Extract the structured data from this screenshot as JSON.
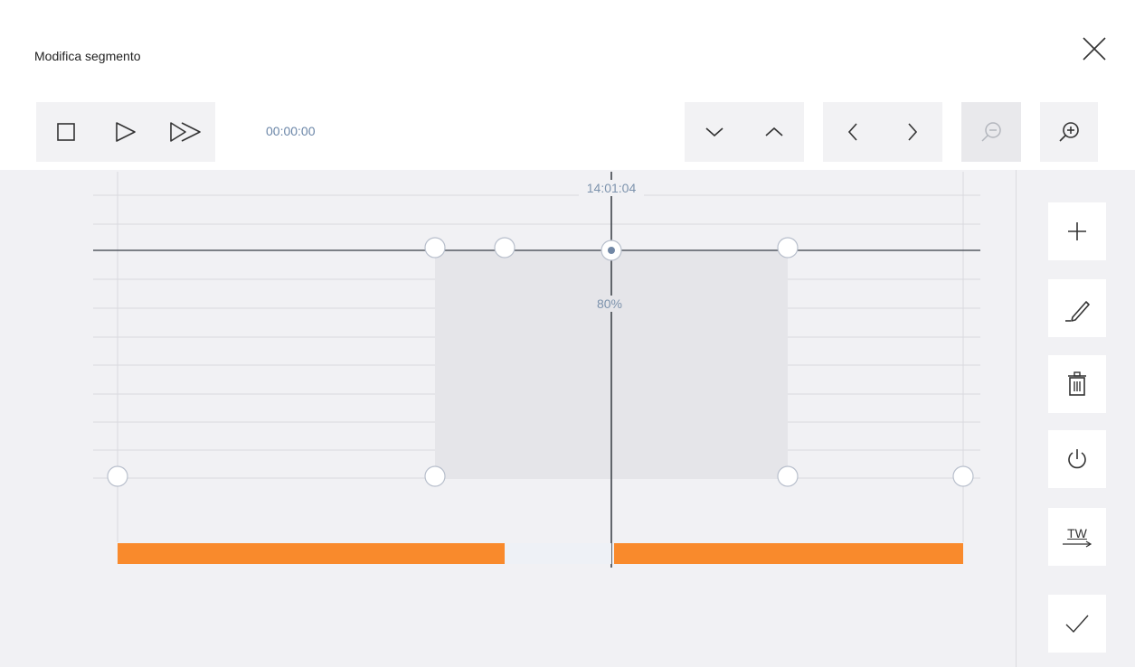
{
  "dialog": {
    "title": "Modifica segmento"
  },
  "toolbar": {
    "timecode": "00:00:00",
    "buttons": [
      "stop",
      "play",
      "fast-forward",
      "move-down",
      "move-up",
      "previous",
      "next",
      "zoom-out",
      "zoom-in"
    ],
    "zoom_out_enabled": false
  },
  "timeline": {
    "cursor_time": "14:01:04",
    "level_label": "80%",
    "envelope_handles": 8,
    "segment_colors": {
      "active": "#f98a2c",
      "inactive": "#eef1f6"
    }
  },
  "side_toolbar": {
    "items": [
      "add",
      "edit",
      "delete",
      "power",
      "tw",
      "confirm"
    ],
    "tw_label": "TW"
  },
  "colors": {
    "accent": "#f98a2c",
    "timecode": "#6b86a8",
    "handle_fill": "#ffffff",
    "handle_stroke": "#b8bfcc",
    "region_fill": "#e5e5e9"
  }
}
